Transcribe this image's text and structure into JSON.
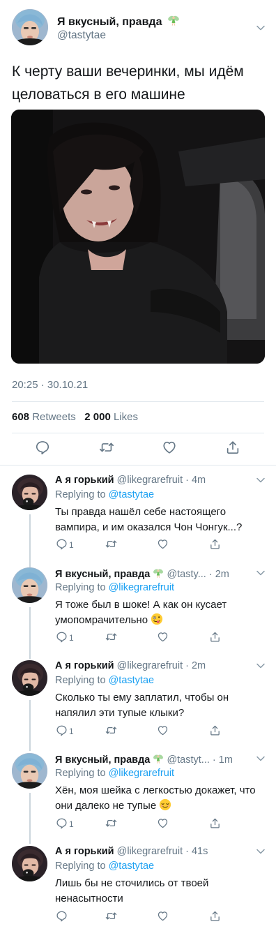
{
  "tweet": {
    "author_name": "Я вкусный, правда",
    "author_handle": "@tastytae",
    "text": "К черту ваши вечеринки, мы идём целоваться в его машине",
    "timestamp": "20:25 · 30.10.21",
    "retweets": "608",
    "retweets_label": "Retweets",
    "likes": "2 000",
    "likes_label": "Likes"
  },
  "replies": [
    {
      "name": "А я горький",
      "handle": "@likegrarefruit",
      "time": "4m",
      "replying_label": "Replying to",
      "replying_to": "@tastytae",
      "text": "Ты правда нашёл себе настоящего вампира, и им оказался Чон Чонгук...?",
      "reply_count": "1"
    },
    {
      "name": "Я вкусный, правда",
      "handle": "@tasty...",
      "time": "2m",
      "replying_label": "Replying to",
      "replying_to": "@likegrarefruit",
      "text": "Я тоже был в шоке! А как он кусает умопомрачительно",
      "reply_count": "1"
    },
    {
      "name": "А я горький",
      "handle": "@likegrarefruit",
      "time": "2m",
      "replying_label": "Replying to",
      "replying_to": "@tastytae",
      "text": "Сколько ты ему заплатил, чтобы он напялил эти тупые клыки?",
      "reply_count": "1"
    },
    {
      "name": "Я вкусный, правда",
      "handle": "@tastyt...",
      "time": "1m",
      "replying_label": "Replying to",
      "replying_to": "@likegrarefruit",
      "text": "Хён, моя шейка с легкостью докажет, что они далеко не тупые",
      "reply_count": "1"
    },
    {
      "name": "А я горький",
      "handle": "@likegrarefruit",
      "time": "41s",
      "replying_label": "Replying to",
      "replying_to": "@tastytae",
      "text": "Лишь бы не сточились от твоей ненасытности",
      "reply_count": ""
    }
  ],
  "icons": {
    "fairy": "fairy-icon",
    "chevron": "chevron-down-icon",
    "reply": "reply-icon",
    "retweet": "retweet-icon",
    "like": "heart-icon",
    "share": "share-icon",
    "grinning_face_with_tongue": "zany-face-emoji",
    "relieved_face": "relieved-face-emoji"
  },
  "colors": {
    "link": "#1da1f2",
    "secondary_text": "#657786",
    "divider": "#e1e8ed"
  }
}
